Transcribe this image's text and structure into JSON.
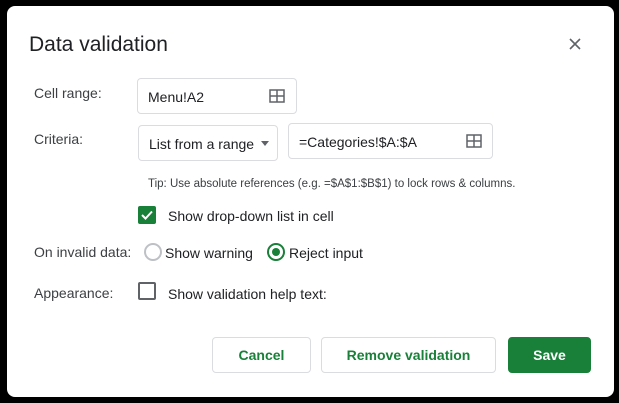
{
  "dialog": {
    "title": "Data validation"
  },
  "cell_range": {
    "label": "Cell range:",
    "value": "Menu!A2",
    "icon": "grid-select-icon"
  },
  "criteria": {
    "label": "Criteria:",
    "type_selected": "List from a range",
    "range_value": "=Categories!$A:$A",
    "icon": "grid-select-icon",
    "tip": "Tip: Use absolute references (e.g. =$A$1:$B$1) to lock rows & columns."
  },
  "dropdown_option": {
    "label": "Show drop-down list in cell",
    "checked": true
  },
  "invalid_data": {
    "label": "On invalid data:",
    "options": [
      {
        "label": "Show warning",
        "selected": false
      },
      {
        "label": "Reject input",
        "selected": true
      }
    ]
  },
  "appearance": {
    "label": "Appearance:",
    "help_text_label": "Show validation help text:",
    "checked": false
  },
  "buttons": {
    "cancel": "Cancel",
    "remove": "Remove validation",
    "save": "Save"
  },
  "colors": {
    "accent": "#188038",
    "border": "#dadce0",
    "text": "#202124"
  }
}
